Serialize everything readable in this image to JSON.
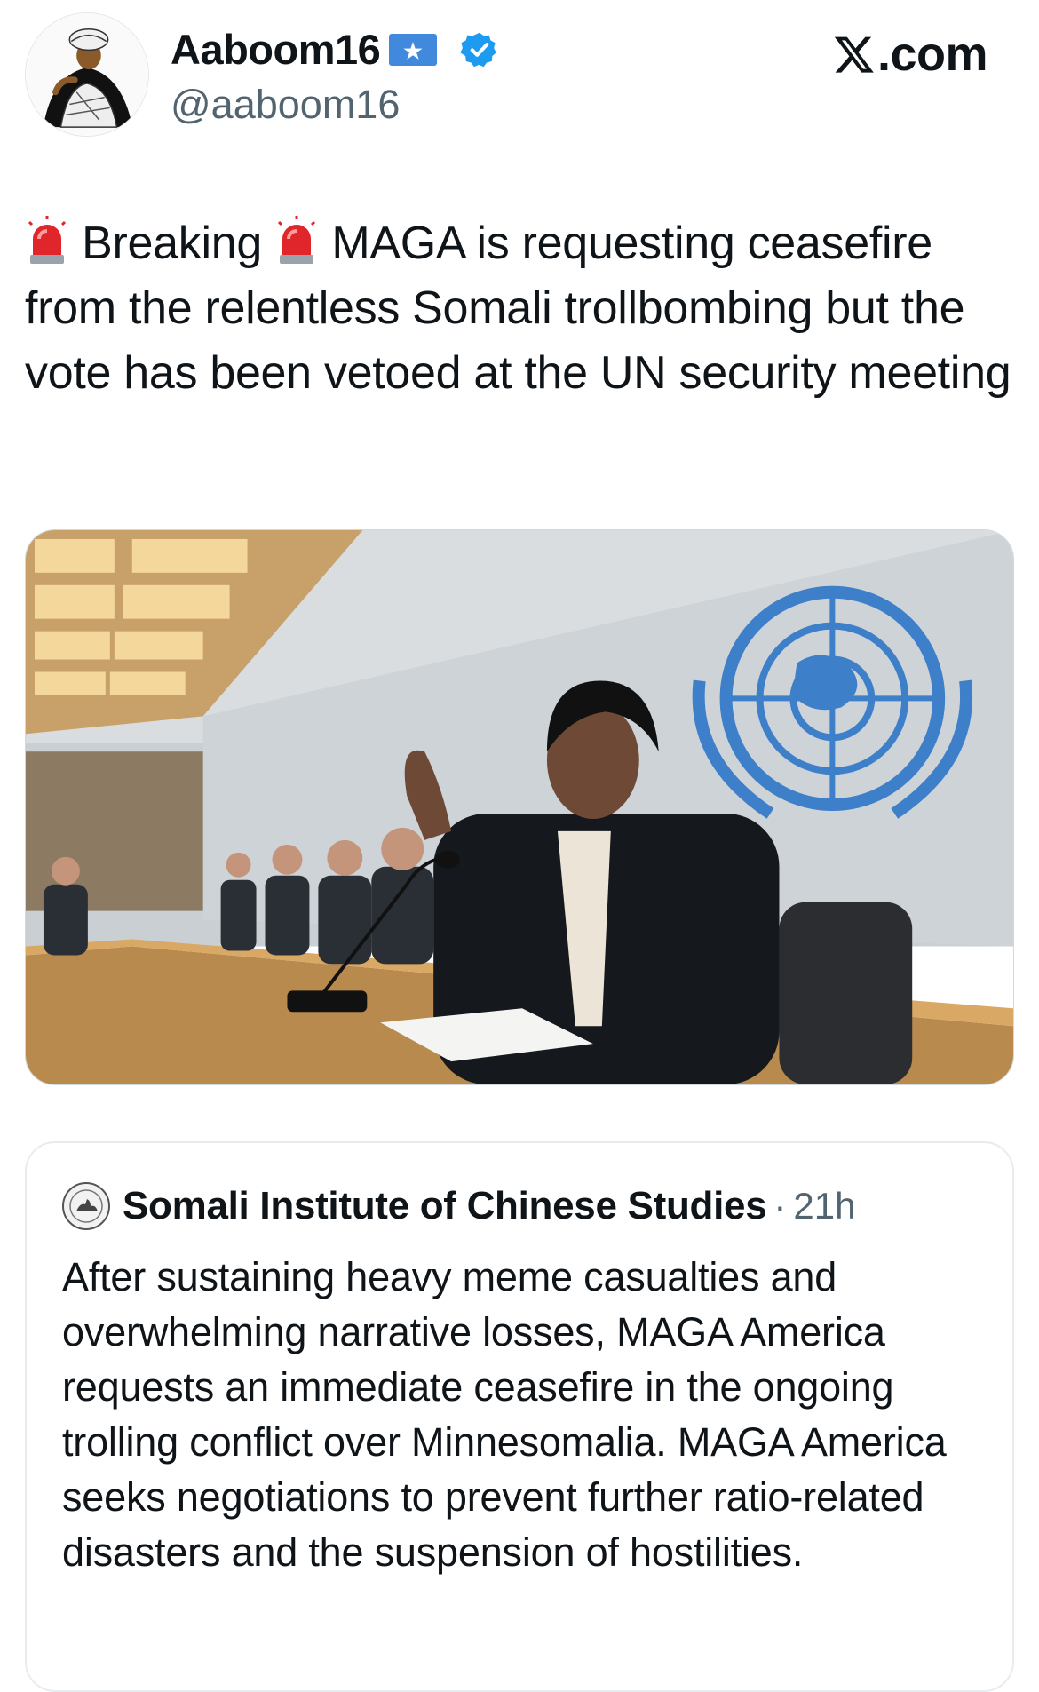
{
  "author": {
    "display_name": "Aaboom16",
    "handle": "@aaboom16",
    "flag_icon": "somalia-flag-icon",
    "verified_icon": "verified-badge-icon",
    "verified_color": "#1d9bf0"
  },
  "watermark": {
    "label": ".com",
    "icon": "x-logo-icon"
  },
  "tweet": {
    "word_breaking": "Breaking",
    "body": "MAGA is requesting ceasefire from the relentless Somali trollbombing but the vote has been vetoed at the UN security meeting",
    "icon": "police-siren-icon"
  },
  "media": {
    "kind": "photo",
    "description_icon": "un-emblem-icon"
  },
  "quote": {
    "author_name": "Somali Institute of Chinese Studies",
    "separator": "·",
    "time": "21h",
    "text": "After sustaining heavy meme casualties and overwhelming narrative losses, MAGA America requests an immediate ceasefire in the ongoing trolling conflict over Minnesomalia. MAGA America seeks negotiations to prevent further ratio-related disasters and the suspension of hostilities."
  },
  "colors": {
    "text": "#0f1419",
    "secondary": "#536471",
    "border": "#e6ecf0",
    "un_blue": "#3d7fc9"
  }
}
